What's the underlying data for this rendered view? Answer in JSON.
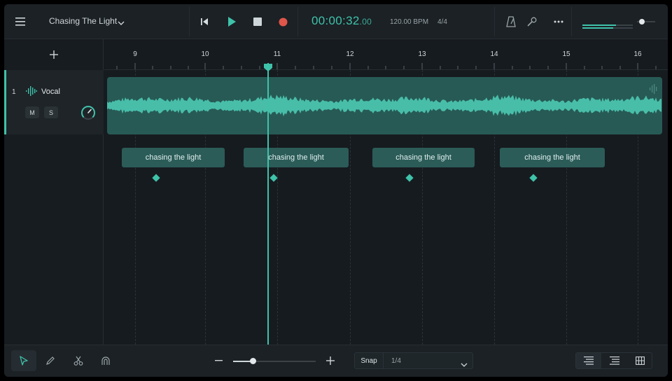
{
  "header": {
    "project_title": "Chasing The Light",
    "time_main": "00:00:32",
    "time_frac": ".00",
    "bpm": "120.00 BPM",
    "time_signature": "4/4",
    "record_color": "#e0564a",
    "accent_color": "#3fc2aa"
  },
  "track_panel": {
    "tracks": [
      {
        "number": "1",
        "name": "Vocal",
        "mute_label": "M",
        "solo_label": "S"
      }
    ]
  },
  "timeline": {
    "bar_numbers": [
      "9",
      "10",
      "11",
      "12",
      "13",
      "14",
      "15",
      "16"
    ],
    "lyrics": [
      {
        "text": "chasing the light"
      },
      {
        "text": "chasing the light"
      },
      {
        "text": "chasing the light"
      },
      {
        "text": "chasing the light"
      }
    ]
  },
  "bottom_bar": {
    "snap_label": "Snap",
    "snap_value": "1/4"
  }
}
